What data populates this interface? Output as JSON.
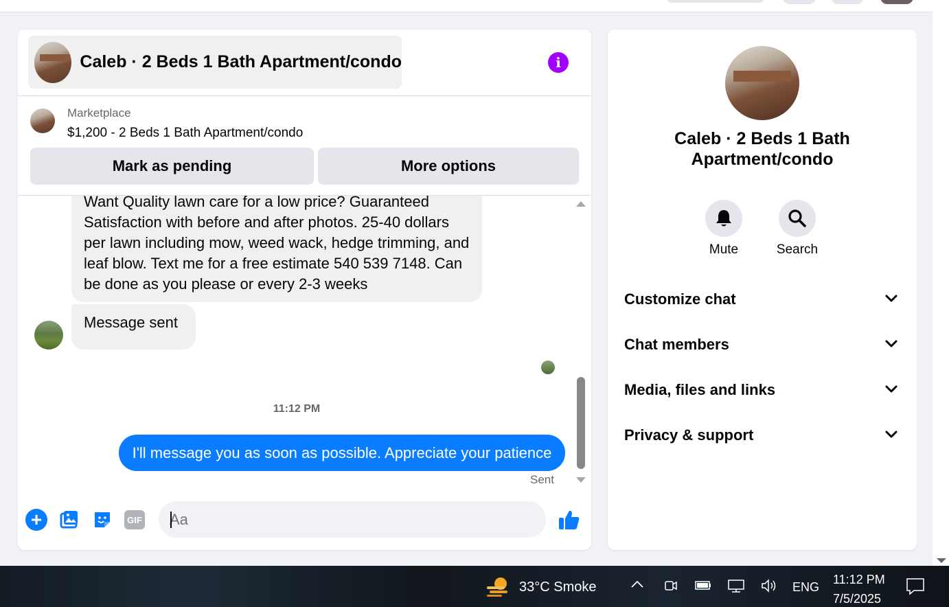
{
  "chat": {
    "title": "Caleb · 2 Beds 1 Bath Apartment/condo",
    "listing": {
      "source": "Marketplace",
      "price_title": "$1,200 - 2 Beds 1 Bath Apartment/condo",
      "mark_pending_label": "Mark as pending",
      "more_options_label": "More options"
    },
    "messages": [
      {
        "direction": "in",
        "text": "Want Quality lawn care for a low price? Guaranteed Satisfaction with before and after photos. 25-40 dollars per lawn including mow, weed wack, hedge trimming, and leaf blow. Text me for a free estimate 540 539 7148. Can be done as you please or every 2-3 weeks"
      },
      {
        "direction": "in",
        "text": "Message sent"
      }
    ],
    "timestamp": "11:12 PM",
    "outgoing": {
      "text": "I'll message you as soon as possible. Appreciate your patience",
      "status": "Sent"
    },
    "composer": {
      "placeholder": "Aa",
      "gif_label": "GIF"
    }
  },
  "side": {
    "name": "Caleb · 2 Beds 1 Bath Apartment/condo",
    "actions": {
      "mute": "Mute",
      "search": "Search"
    },
    "sections": [
      "Customize chat",
      "Chat members",
      "Media, files and links",
      "Privacy & support"
    ]
  },
  "taskbar": {
    "weather": "33°C  Smoke",
    "language": "ENG",
    "time": "11:12 PM",
    "date": "7/5/2025"
  },
  "colors": {
    "accent": "#0a7cff",
    "info": "#a200ff"
  }
}
